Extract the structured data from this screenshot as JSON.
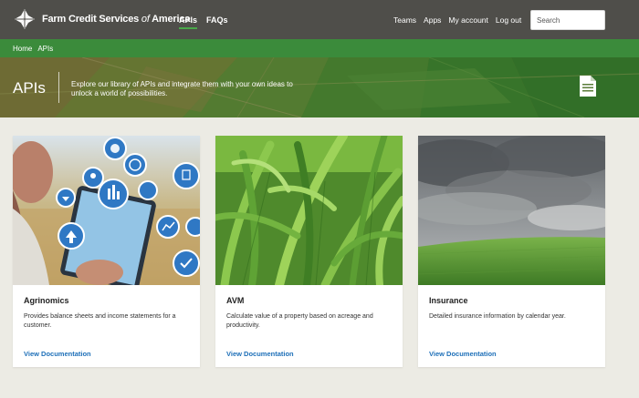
{
  "header": {
    "brand_main": "Farm Credit Services",
    "brand_of": "of",
    "brand_tail": "America",
    "nav_primary": [
      {
        "label": "APIs",
        "active": true
      },
      {
        "label": "FAQs",
        "active": false
      }
    ],
    "nav_secondary": [
      "Teams",
      "Apps",
      "My account",
      "Log out"
    ],
    "search_placeholder": "Search"
  },
  "breadcrumb": {
    "items": [
      "Home",
      "APIs"
    ],
    "separator": "›"
  },
  "hero": {
    "title": "APIs",
    "description": "Explore our library of APIs and integrate them with your own ideas to unlock a world of possibilities.",
    "icon": "document-icon"
  },
  "cards": [
    {
      "title": "Agrinomics",
      "description": "Provides balance sheets and income statements for a customer.",
      "link": "View Documentation",
      "image": "tablet-icons-photo"
    },
    {
      "title": "AVM",
      "description": "Calculate value of a property based on acreage and productivity.",
      "link": "View Documentation",
      "image": "corn-leaves-photo"
    },
    {
      "title": "Insurance",
      "description": "Detailed insurance information by calendar year.",
      "link": "View Documentation",
      "image": "storm-field-photo"
    }
  ],
  "colors": {
    "topbar": "#4f4e4a",
    "breadcrumb": "#3b8b3b",
    "link": "#1d6fb8",
    "page_bg": "#ecebe4"
  }
}
